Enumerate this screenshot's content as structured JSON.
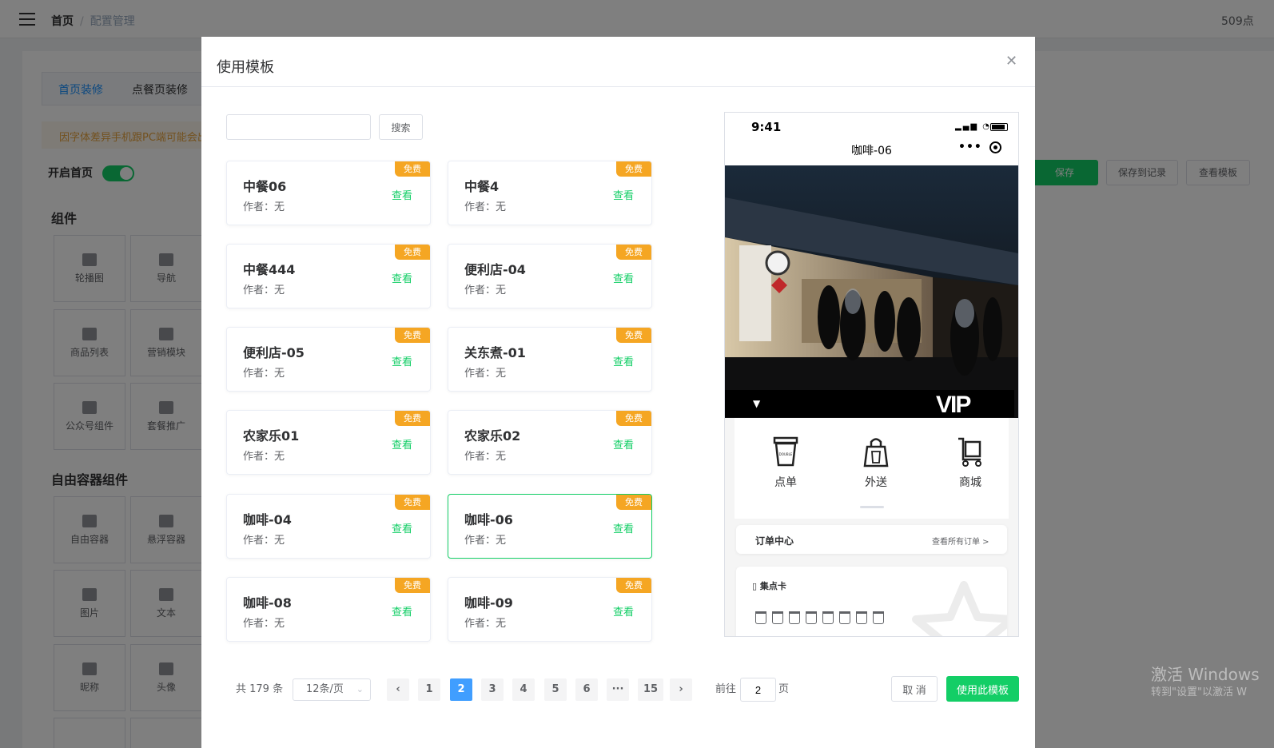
{
  "topbar": {
    "breadcrumb_home": "首页",
    "breadcrumb_sep": "/",
    "breadcrumb_current": "配置管理",
    "right_text": "509点"
  },
  "background": {
    "tabs": [
      "首页装修",
      "点餐页装修"
    ],
    "notice": "因字体差异手机跟PC端可能会出",
    "switch_label": "开启首页",
    "section_components": "组件",
    "components": [
      "轮播图",
      "导航",
      "商品列表",
      "营销模块",
      "公众号组件",
      "套餐推广"
    ],
    "section_free": "自由容器组件",
    "free_components": [
      "自由容器",
      "悬浮容器",
      "图片",
      "文本",
      "昵称",
      "头像"
    ],
    "actions": [
      "保存",
      "保存到记录",
      "查看模板"
    ],
    "watermark_title": "激活 Windows",
    "watermark_sub": "转到\"设置\"以激活 W"
  },
  "dialog": {
    "title": "使用模板",
    "close_icon": "close-icon",
    "search_placeholder": "",
    "search_button": "搜索",
    "author_prefix": "作者：",
    "view_label": "查看",
    "badge_label": "免费",
    "templates": [
      {
        "name": "中餐06",
        "author": "作者：无",
        "badge": "免费",
        "view": "查看"
      },
      {
        "name": "中餐4",
        "author": "作者：无",
        "badge": "免费",
        "view": "查看"
      },
      {
        "name": "中餐444",
        "author": "作者：无",
        "badge": "免费",
        "view": "查看"
      },
      {
        "name": "便利店-04",
        "author": "作者：无",
        "badge": "免费",
        "view": "查看"
      },
      {
        "name": "便利店-05",
        "author": "作者：无",
        "badge": "免费",
        "view": "查看"
      },
      {
        "name": "关东煮-01",
        "author": "作者：无",
        "badge": "免费",
        "view": "查看"
      },
      {
        "name": "农家乐01",
        "author": "作者：无",
        "badge": "免费",
        "view": "查看"
      },
      {
        "name": "农家乐02",
        "author": "作者：无",
        "badge": "免费",
        "view": "查看"
      },
      {
        "name": "咖啡-04",
        "author": "作者：无",
        "badge": "免费",
        "view": "查看"
      },
      {
        "name": "咖啡-06",
        "author": "作者：无",
        "badge": "免费",
        "view": "查看",
        "selected": true
      },
      {
        "name": "咖啡-08",
        "author": "作者：无",
        "badge": "免费",
        "view": "查看"
      },
      {
        "name": "咖啡-09",
        "author": "作者：无",
        "badge": "免费",
        "view": "查看"
      }
    ],
    "pagination": {
      "total": "共 179 条",
      "page_size": "12条/页",
      "prev": "‹",
      "next": "›",
      "pages": [
        "1",
        "2",
        "3",
        "4",
        "5",
        "6",
        "···",
        "15"
      ],
      "current": "2",
      "goto_prefix": "前往",
      "goto_value": "2",
      "goto_suffix": "页"
    },
    "cancel_button": "取 消",
    "use_button": "使用此模板"
  },
  "preview": {
    "time": "9:41",
    "title": "咖啡-06",
    "vip": "VIP",
    "quick_items": [
      "点单",
      "外送",
      "商城"
    ],
    "cup_text": "DOUBLE",
    "order_center": "订单中心",
    "order_all": "查看所有订单 >",
    "stamp_title": "集点卡"
  },
  "colors": {
    "accent_green": "#13ce66",
    "badge_orange": "#f5a623",
    "page_active_blue": "#409eff"
  }
}
